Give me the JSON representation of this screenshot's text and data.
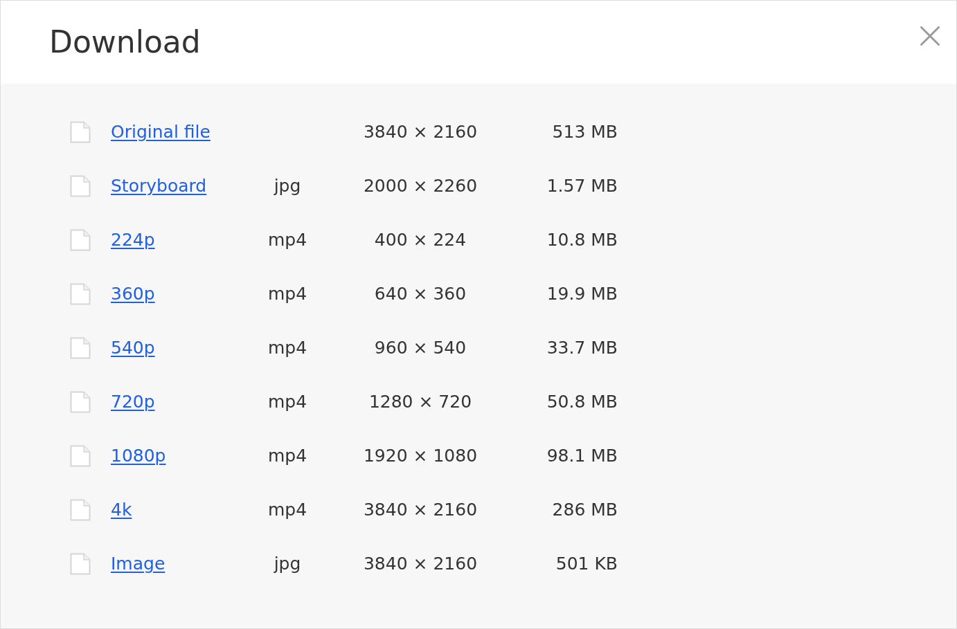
{
  "dialog": {
    "title": "Download"
  },
  "files": [
    {
      "label": "Original file",
      "dimensions": "3840 × 2160",
      "size": "513 MB"
    },
    {
      "label": "Storyboard",
      "type": "jpg",
      "dimensions": "2000 × 2260",
      "size": "1.57 MB"
    },
    {
      "label": "224p",
      "type": "mp4",
      "dimensions": "400 × 224",
      "size": "10.8 MB"
    },
    {
      "label": "360p",
      "type": "mp4",
      "dimensions": "640 × 360",
      "size": "19.9 MB"
    },
    {
      "label": "540p",
      "type": "mp4",
      "dimensions": "960 × 540",
      "size": "33.7 MB"
    },
    {
      "label": "720p",
      "type": "mp4",
      "dimensions": "1280 × 720",
      "size": "50.8 MB"
    },
    {
      "label": "1080p",
      "type": "mp4",
      "dimensions": "1920 × 1080",
      "size": "98.1 MB"
    },
    {
      "label": "4k",
      "type": "mp4",
      "dimensions": "3840 × 2160",
      "size": "286 MB"
    },
    {
      "label": "Image",
      "type": "jpg",
      "dimensions": "3840 × 2160",
      "size": "501 KB"
    }
  ]
}
